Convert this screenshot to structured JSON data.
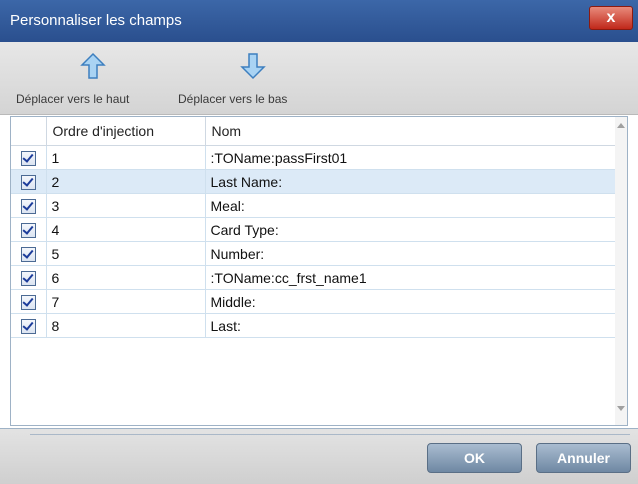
{
  "dialog": {
    "title": "Personnaliser les champs",
    "close_label": "x"
  },
  "toolbar": {
    "move_up_label": "Déplacer vers le haut",
    "move_down_label": "Déplacer vers le bas"
  },
  "table": {
    "columns": [
      "Ordre d'injection",
      "Nom"
    ],
    "rows": [
      {
        "order": "1",
        "name": ":TOName:passFirst01",
        "checked": true
      },
      {
        "order": "2",
        "name": "Last Name:",
        "checked": true,
        "selected": true
      },
      {
        "order": "3",
        "name": "Meal:",
        "checked": true
      },
      {
        "order": "4",
        "name": "Card Type:",
        "checked": true
      },
      {
        "order": "5",
        "name": "Number:",
        "checked": true
      },
      {
        "order": "6",
        "name": ":TOName:cc_frst_name1",
        "checked": true
      },
      {
        "order": "7",
        "name": "Middle:",
        "checked": true
      },
      {
        "order": "8",
        "name": "Last:",
        "checked": true
      }
    ]
  },
  "footer": {
    "ok_label": "OK",
    "cancel_label": "Annuler"
  },
  "colors": {
    "titlebar": "#2f5797",
    "selected_row": "#dceaf7",
    "button": "#7f96b0"
  }
}
